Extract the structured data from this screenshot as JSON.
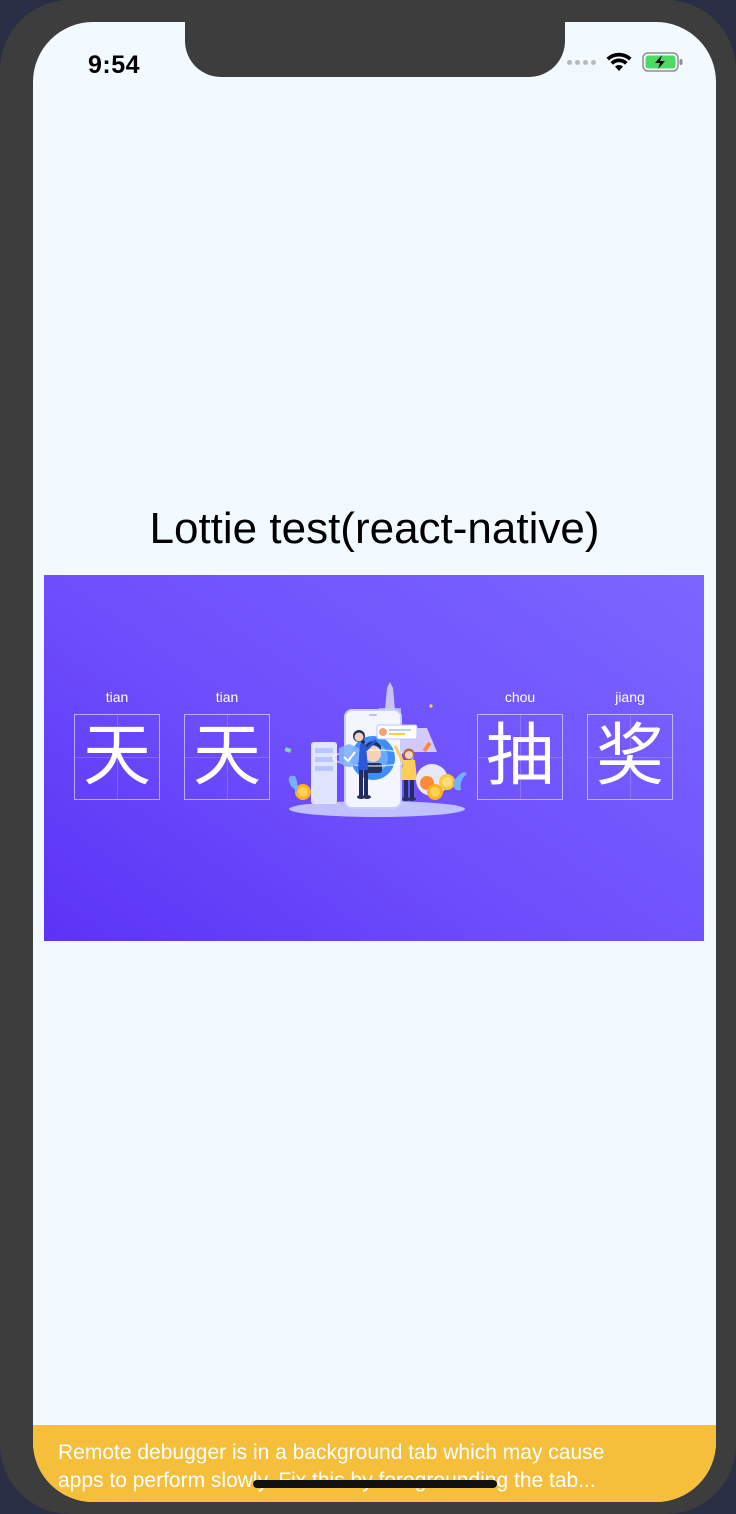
{
  "status_bar": {
    "time": "9:54",
    "icons": [
      "signal-dots-icon",
      "wifi-icon",
      "battery-charging-icon"
    ]
  },
  "main": {
    "title": "Lottie test(react-native)"
  },
  "banner": {
    "background_start": "#5b33f6",
    "background_end": "#7b66ff",
    "characters": [
      {
        "pinyin": "tian",
        "char": "天"
      },
      {
        "pinyin": "tian",
        "char": "天"
      },
      {
        "pinyin": "chou",
        "char": "抽"
      },
      {
        "pinyin": "jiang",
        "char": "奖"
      }
    ]
  },
  "debug_banner": {
    "line1": "Remote debugger is in a background tab which may cause",
    "line2": "apps to perform slowly. Fix this by foregrounding the tab...",
    "color": "#f5be3b"
  }
}
